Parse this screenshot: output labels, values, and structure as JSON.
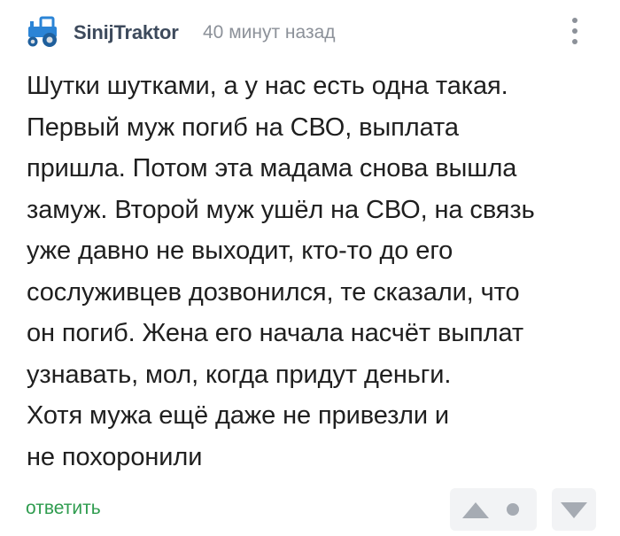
{
  "comment": {
    "author": "SinijTraktor",
    "time": "40 минут назад",
    "avatar_icon": "blue-tractor-icon",
    "text_lines": [
      "Шутки шутками, а у нас есть одна такая.",
      "Первый муж погиб на СВО, выплата",
      "пришла. Потом эта мадама снова вышла",
      "замуж. Второй муж ушёл на СВО, на связь",
      "уже давно не выходит, кто-то до его",
      "сослуживцев дозвонился, те сказали, что",
      "он погиб. Жена его начала насчёт выплат",
      "узнавать, мол, когда придут деньги.",
      "Хотя мужа ещё даже не привезли и",
      "не похоронили"
    ]
  },
  "actions": {
    "reply_label": "ответить",
    "menu_icon": "more-vertical-icon",
    "upvote_icon": "triangle-up-icon",
    "rating_icon": "dot-icon",
    "downvote_icon": "triangle-down-icon"
  },
  "colors": {
    "author": "#3d4a5c",
    "muted": "#8c9199",
    "text": "#1f1f1f",
    "reply": "#2f9c4f",
    "vote_bg": "#f2f3f5",
    "vote_icon": "#a6abb3",
    "tractor_body": "#2b84d6"
  }
}
